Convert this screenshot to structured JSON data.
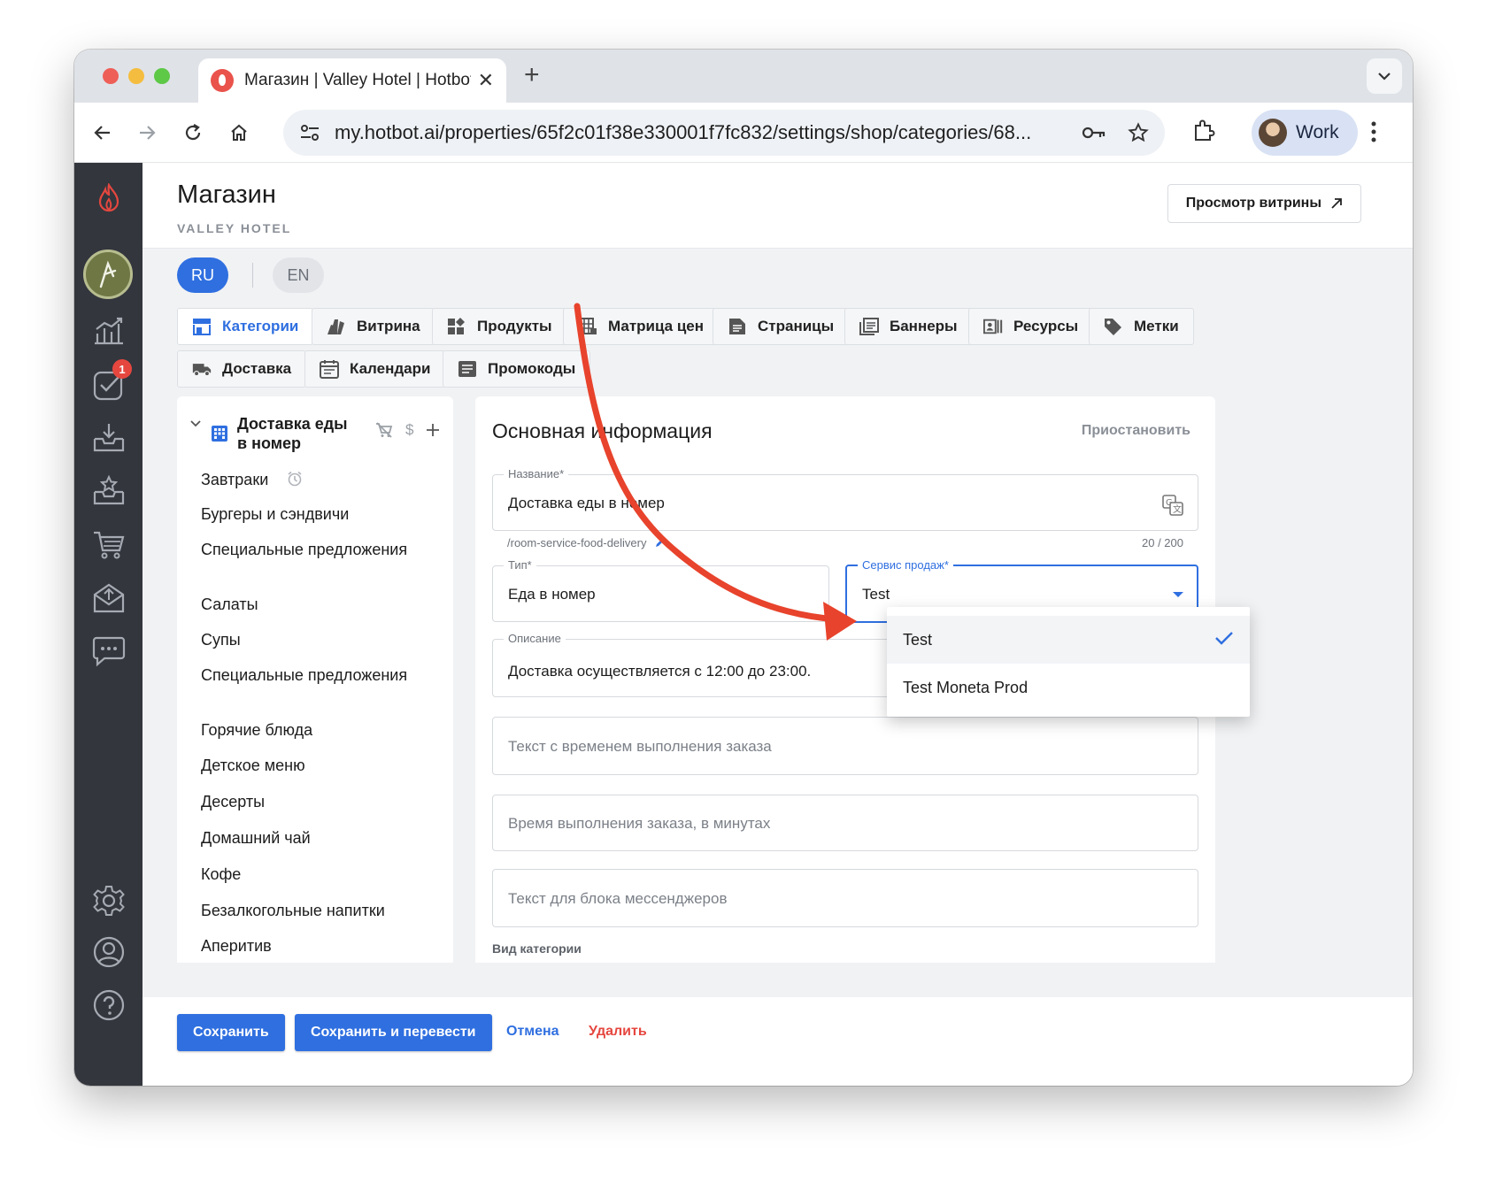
{
  "browser": {
    "tab_title": "Магазин | Valley Hotel | Hotbot",
    "url": "my.hotbot.ai/properties/65f2c01f38e330001f7fc832/settings/shop/categories/68...",
    "profile_name": "Work"
  },
  "sidebar": {
    "notification_count": "1"
  },
  "header": {
    "title": "Магазин",
    "subtitle": "VALLEY HOTEL",
    "storefront_button": "Просмотр витрины"
  },
  "languages": [
    "RU",
    "EN"
  ],
  "tabs": [
    {
      "label": "Категории",
      "icon": "store-icon",
      "active": true
    },
    {
      "label": "Витрина",
      "icon": "storefront-icon"
    },
    {
      "label": "Продукты",
      "icon": "products-icon"
    },
    {
      "label": "Матрица цен",
      "icon": "price-matrix-icon"
    },
    {
      "label": "Страницы",
      "icon": "pages-icon"
    },
    {
      "label": "Баннеры",
      "icon": "banners-icon"
    },
    {
      "label": "Ресурсы",
      "icon": "resources-icon"
    },
    {
      "label": "Метки",
      "icon": "tags-icon"
    },
    {
      "label": "Доставка",
      "icon": "truck-icon"
    },
    {
      "label": "Календари",
      "icon": "calendar-icon"
    },
    {
      "label": "Промокоды",
      "icon": "promo-icon"
    }
  ],
  "tree": {
    "root": "Доставка еды в номер",
    "items": [
      "Завтраки",
      "Бургеры и сэндвичи",
      "Специальные предложения",
      "Салаты",
      "Супы",
      "Специальные предложения",
      "Горячие блюда",
      "Детское меню",
      "Десерты",
      "Домашний чай",
      "Кофе",
      "Безалкогольные напитки",
      "Аперитив"
    ]
  },
  "form": {
    "title": "Основная информация",
    "suspend_label": "Приостановить",
    "name": {
      "label": "Название*",
      "value": "Доставка еды в номер",
      "slug": "/room-service-food-delivery",
      "counter": "20 / 200"
    },
    "type": {
      "label": "Тип*",
      "value": "Еда в номер"
    },
    "sales_service": {
      "label": "Сервис продаж*",
      "value": "Test",
      "options": [
        "Test",
        "Test Moneta Prod"
      ]
    },
    "description": {
      "label": "Описание",
      "value": "Доставка осуществляется с 12:00 до 23:00."
    },
    "order_time_text_placeholder": "Текст с временем выполнения заказа",
    "order_time_minutes_placeholder": "Время выполнения заказа, в минутах",
    "messenger_text_placeholder": "Текст для блока мессенджеров",
    "category_view_label": "Вид категории"
  },
  "footer": {
    "save": "Сохранить",
    "save_translate": "Сохранить и перевести",
    "cancel": "Отмена",
    "delete": "Удалить"
  },
  "colors": {
    "accent": "#2f6fe0",
    "danger": "#e5473f",
    "sidebar": "#33363d",
    "annotation_arrow": "#e8432c"
  }
}
